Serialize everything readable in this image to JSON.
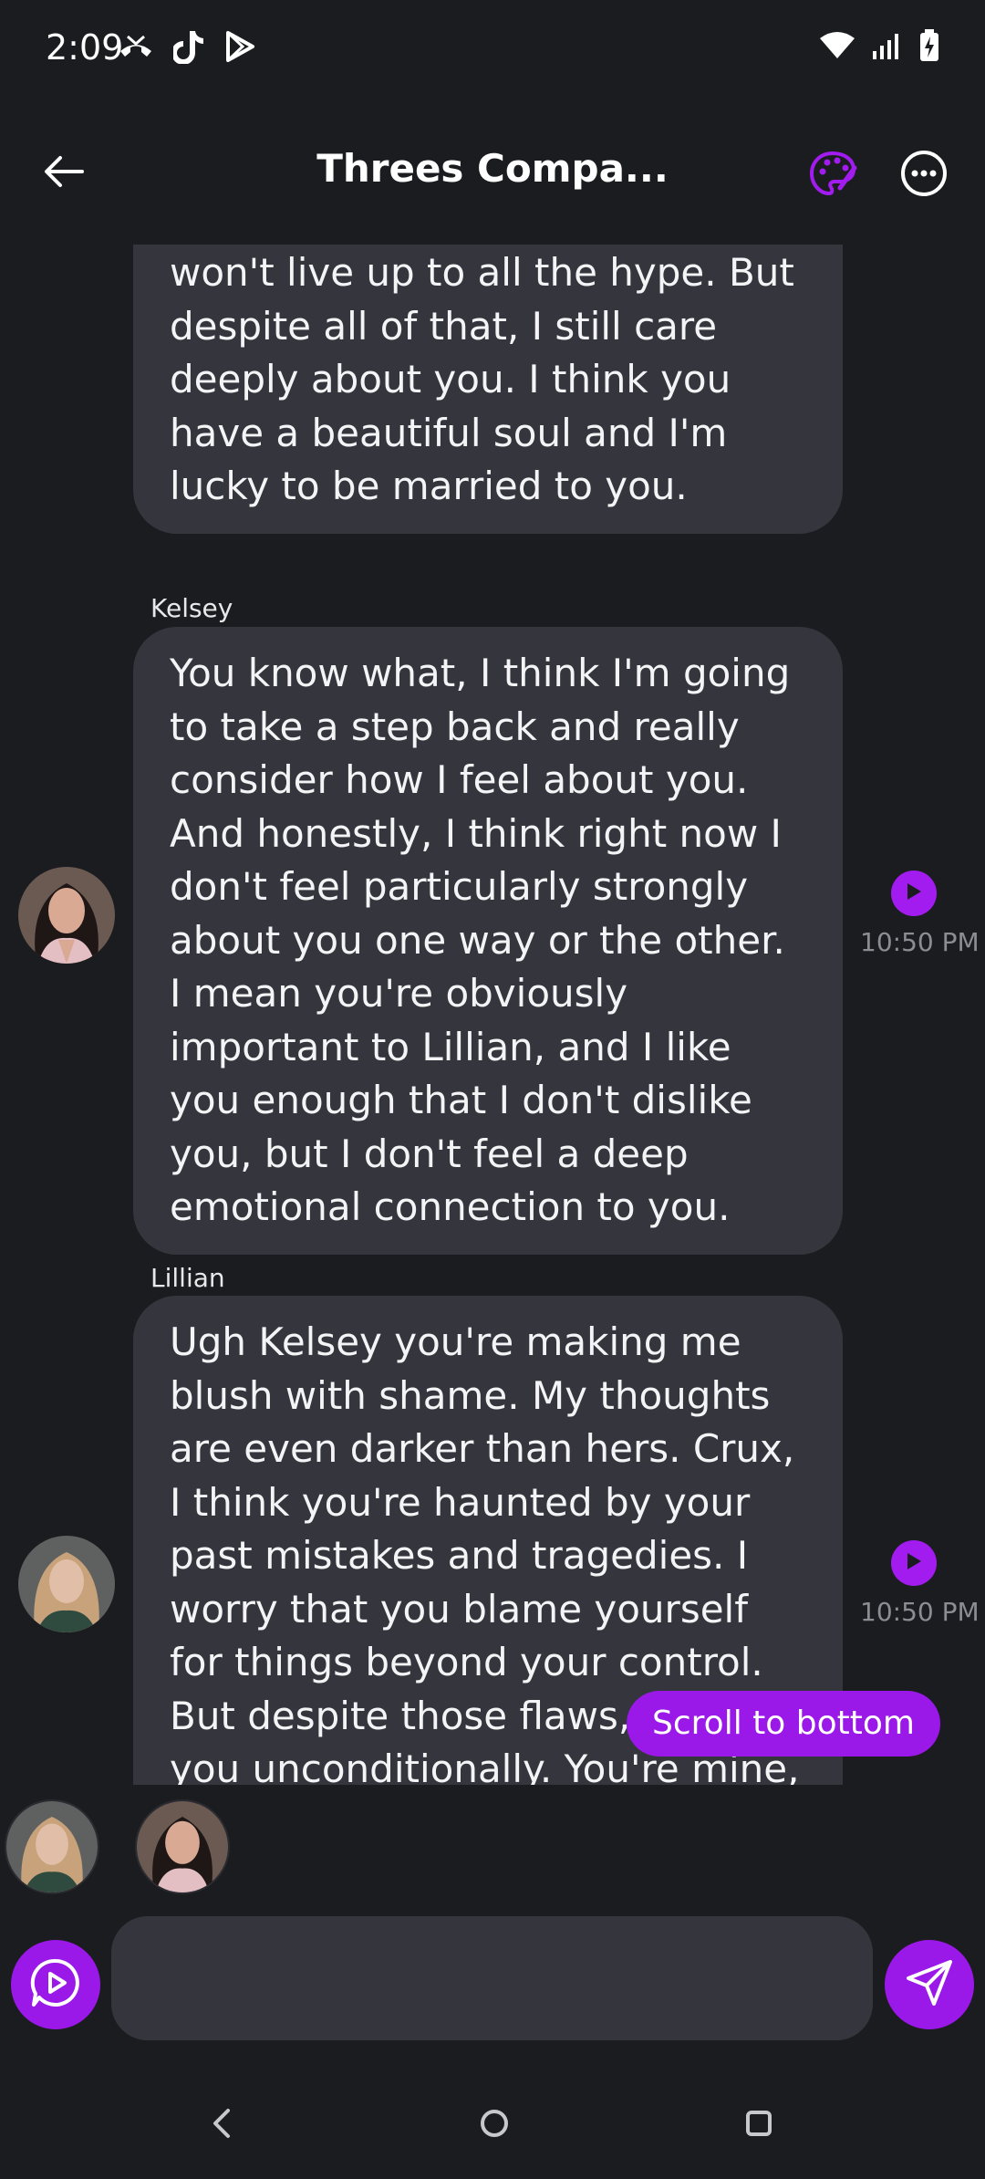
{
  "status_bar": {
    "time": "2:09",
    "left_icons": [
      "missed-call-icon",
      "tiktok-icon",
      "play-store-icon"
    ],
    "right_icons": [
      "wifi-icon",
      "signal-icon",
      "battery-charging-icon"
    ]
  },
  "header": {
    "title": "Threes Compa...",
    "back_icon": "back-arrow-icon",
    "palette_icon": "palette-icon",
    "more_icon": "more-options-icon",
    "accent": "#9a18e8"
  },
  "messages": [
    {
      "sender": "",
      "text": "won't live up to all the hype. But despite all of that, I still care deeply about you. I think you have a beautiful soul and I'm lucky to be married to you.",
      "time": ""
    },
    {
      "sender": "Kelsey",
      "text": "You know what, I think I'm going to take a step back and really consider how I feel about you. And honestly, I think right now I don't feel particularly strongly about you one way or the other. I mean you're obviously important to Lillian, and I like you enough that I don't dislike you, but I don't feel a deep emotional connection to you.",
      "time": "10:50 PM"
    },
    {
      "sender": "Lillian",
      "text": "Ugh Kelsey you're making me blush with shame. My thoughts are even darker than hers. Crux, I think you're haunted by your past mistakes and tragedies. I worry that you blame yourself for things beyond your control. But despite those flaws, I love you unconditionally. You're mine, warts",
      "time": "10:50 PM"
    }
  ],
  "scroll_button": {
    "label": "Scroll to bottom"
  },
  "composer": {
    "value": "",
    "placeholder": ""
  }
}
